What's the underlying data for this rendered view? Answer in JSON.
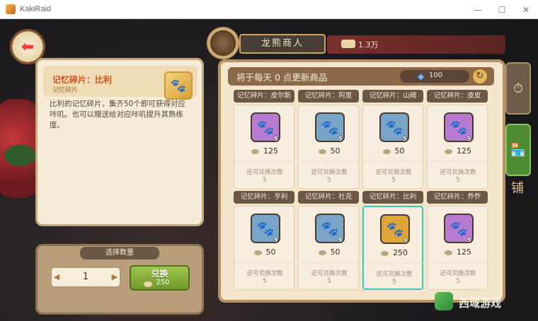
{
  "window": {
    "title": "KakiRaid",
    "minimize": "—",
    "maximize": "☐",
    "close": "✕"
  },
  "back_button": {
    "icon": "arrow-left-icon"
  },
  "detail": {
    "title": "记忆碎片：比利",
    "subtitle": "记忆碎片",
    "description": "比利的记忆碎片，集齐50个即可获得对应咔叽。也可以赠送给对应咔叽提升其熟练度。"
  },
  "quantity": {
    "label": "选择数量",
    "value": "1",
    "minus": "◀",
    "plus": "▶",
    "exchange_label": "兑换",
    "exchange_cost": "250"
  },
  "shop": {
    "title": "龙熊商人",
    "currency": "1.3万",
    "refresh_text": "将于每天 0 点更新商品",
    "gems": "100",
    "refresh_icon": "refresh-icon",
    "items": [
      {
        "name": "记忆碎片：皮尔斯",
        "price": "125",
        "count": "5",
        "limit_label": "还可兑换次数",
        "limit": "5",
        "frame": "#b77bd0"
      },
      {
        "name": "记忆碎片：阿里",
        "price": "50",
        "count": "5",
        "limit_label": "还可兑换次数",
        "limit": "5",
        "frame": "#7aa3c8"
      },
      {
        "name": "记忆碎片：山姆",
        "price": "50",
        "count": "5",
        "limit_label": "还可兑换次数",
        "limit": "5",
        "frame": "#7aa3c8"
      },
      {
        "name": "记忆碎片：皮皮",
        "price": "125",
        "count": "5",
        "limit_label": "还可兑换次数",
        "limit": "5",
        "frame": "#b77bd0"
      },
      {
        "name": "记忆碎片：亨利",
        "price": "50",
        "count": "5",
        "limit_label": "还可兑换次数",
        "limit": "5",
        "frame": "#7aa3c8"
      },
      {
        "name": "记忆碎片：杜克",
        "price": "50",
        "count": "5",
        "limit_label": "还可兑换次数",
        "limit": "5",
        "frame": "#7aa3c8"
      },
      {
        "name": "记忆碎片：比利",
        "price": "250",
        "count": "5",
        "limit_label": "还可兑换次数",
        "limit": "5",
        "frame": "#e0a53a"
      },
      {
        "name": "记忆碎片：乔乔",
        "price": "125",
        "count": "5",
        "limit_label": "还可兑换次数",
        "limit": "5",
        "frame": "#b77bd0"
      }
    ]
  },
  "side_tabs": {
    "tab3": "铺"
  },
  "watermark": {
    "text": "西域游戏"
  }
}
